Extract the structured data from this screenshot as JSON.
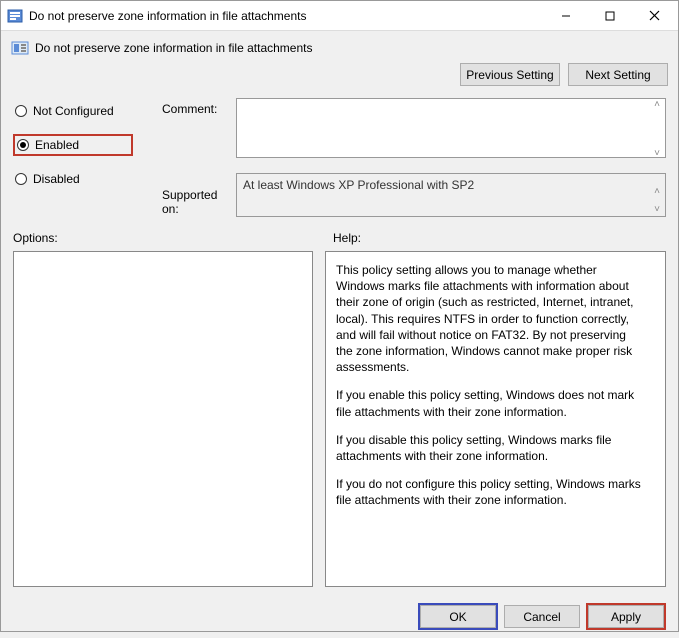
{
  "window": {
    "title": "Do not preserve zone information in file attachments"
  },
  "subheader": {
    "text": "Do not preserve zone information in file attachments"
  },
  "nav": {
    "prev": "Previous Setting",
    "next": "Next Setting"
  },
  "radios": {
    "not_configured": "Not Configured",
    "enabled": "Enabled",
    "disabled": "Disabled"
  },
  "labels": {
    "comment": "Comment:",
    "supported_on": "Supported on:",
    "options": "Options:",
    "help": "Help:"
  },
  "fields": {
    "comment_value": "",
    "supported_value": "At least Windows XP Professional with SP2"
  },
  "help": {
    "p1": "This policy setting allows you to manage whether Windows marks file attachments with information about their zone of origin (such as restricted, Internet, intranet, local). This requires NTFS in order to function correctly, and will fail without notice on FAT32. By not preserving the zone information, Windows cannot make proper risk assessments.",
    "p2": "If you enable this policy setting, Windows does not mark file attachments with their zone information.",
    "p3": "If you disable this policy setting, Windows marks file attachments with their zone information.",
    "p4": "If you do not configure this policy setting, Windows marks file attachments with their zone information."
  },
  "footer": {
    "ok": "OK",
    "cancel": "Cancel",
    "apply": "Apply"
  }
}
